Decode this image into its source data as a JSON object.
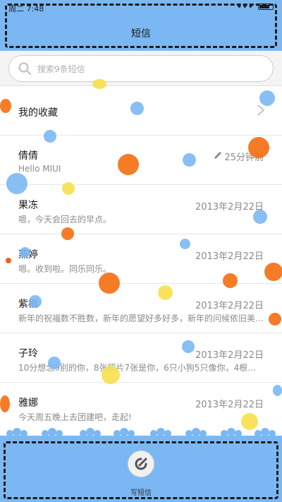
{
  "status_bar": {
    "time": "周二 7:48",
    "indicators": "•••"
  },
  "header": {
    "title": "短信"
  },
  "search": {
    "placeholder": "搜索9条短信",
    "icon": "search-icon"
  },
  "favorites": {
    "label": "我的收藏",
    "icon": "chevron-right-icon"
  },
  "conversations": [
    {
      "name": "倩倩",
      "preview": "Hello MIUI",
      "date": "25分钟前",
      "draft": true,
      "unread": false
    },
    {
      "name": "果冻",
      "preview": "嗯，今天会回去的早点。",
      "date": "2013年2月22日",
      "draft": false,
      "unread": false
    },
    {
      "name": "燕婷",
      "preview": "嗯。收到啦。同乐同乐。",
      "date": "2013年2月22日",
      "draft": false,
      "unread": true
    },
    {
      "name": "紫楠",
      "preview": "新年的祝福数不胜数，新年的愿望好多好多，新年的问候依旧美…",
      "date": "2013年2月22日",
      "draft": false,
      "unread": false
    },
    {
      "name": "子玲",
      "preview": "10分想念9别的你，8张照片7张是你，6只小狗5只像你，4根骨…",
      "date": "2013年2月22日",
      "draft": false,
      "unread": false
    },
    {
      "name": "雅娜",
      "preview": "今天周五晚上去团建吧，走起!",
      "date": "2013年2月22日",
      "draft": false,
      "unread": false
    }
  ],
  "footer": {
    "compose_label": "写短信",
    "icon": "compose-icon"
  },
  "colors": {
    "accent": "#7bb8f3",
    "bubble_orange": "#f46d0f",
    "bubble_yellow": "#f6e04b",
    "unread": "#f0621a"
  }
}
